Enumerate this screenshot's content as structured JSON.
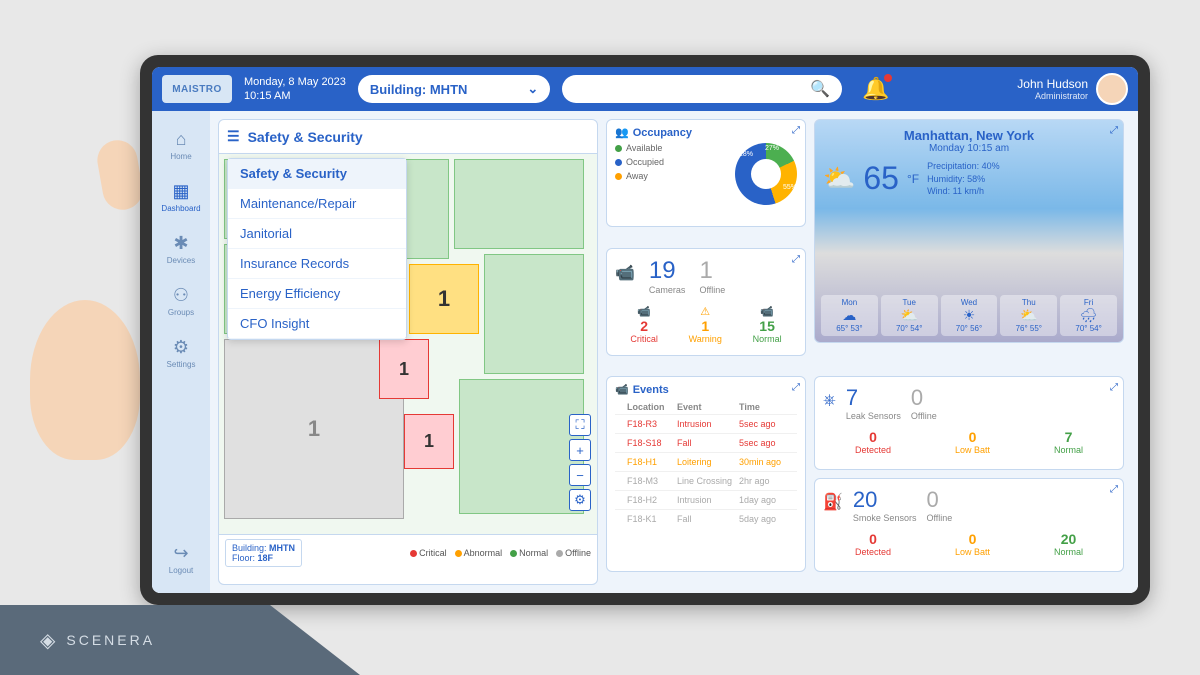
{
  "brand": "MAISTRO",
  "vendor": "SCENERA",
  "datetime": {
    "date": "Monday, 8 May 2023",
    "time": "10:15 AM"
  },
  "building_selector": {
    "label": "Building: MHTN"
  },
  "user": {
    "name": "John Hudson",
    "role": "Administrator"
  },
  "sidebar": {
    "items": [
      {
        "label": "Home",
        "icon": "⌂"
      },
      {
        "label": "Dashboard",
        "icon": "▦"
      },
      {
        "label": "Devices",
        "icon": "✱"
      },
      {
        "label": "Groups",
        "icon": "⚇"
      },
      {
        "label": "Settings",
        "icon": "⚙"
      }
    ],
    "logout": {
      "label": "Logout",
      "icon": "↪"
    }
  },
  "floorplan": {
    "title": "Safety & Security",
    "menu": [
      "Safety & Security",
      "Maintenance/Repair",
      "Janitorial",
      "Insurance Records",
      "Energy Efficiency",
      "CFO Insight"
    ],
    "building_label": "Building:",
    "building_val": "MHTN",
    "floor_label": "Floor:",
    "floor_val": "18F",
    "markers": {
      "gray": "1",
      "orange": "1",
      "red1": "1",
      "red2": "1"
    },
    "legend": [
      {
        "label": "Critical",
        "color": "#e53935"
      },
      {
        "label": "Abnormal",
        "color": "#ffa000"
      },
      {
        "label": "Normal",
        "color": "#43a047"
      },
      {
        "label": "Offline",
        "color": "#aaa"
      }
    ]
  },
  "occupancy": {
    "title": "Occupancy",
    "legend": [
      {
        "label": "Available",
        "color": "#4caf50"
      },
      {
        "label": "Occupied",
        "color": "#2962c7"
      },
      {
        "label": "Away",
        "color": "#ffb300"
      }
    ],
    "pct": {
      "avail": "18%",
      "occ": "55%",
      "away": "27%"
    }
  },
  "cameras": {
    "count": "19",
    "count_label": "Cameras",
    "offline": "1",
    "offline_label": "Offline",
    "stats": [
      {
        "n": "2",
        "label": "Critical",
        "cls": "clr-red",
        "ico": "📹"
      },
      {
        "n": "1",
        "label": "Warning",
        "cls": "clr-org",
        "ico": "⚠"
      },
      {
        "n": "15",
        "label": "Normal",
        "cls": "clr-grn",
        "ico": "📹"
      }
    ]
  },
  "events": {
    "title": "Events",
    "headers": [
      "",
      "Location",
      "Event",
      "Time"
    ],
    "rows": [
      {
        "color": "#e53935",
        "cls": "clr-red",
        "loc": "F18-R3",
        "ev": "Intrusion",
        "time": "5sec ago"
      },
      {
        "color": "#e53935",
        "cls": "clr-red",
        "loc": "F18-S18",
        "ev": "Fall",
        "time": "5sec ago"
      },
      {
        "color": "#ffa000",
        "cls": "clr-org",
        "loc": "F18-H1",
        "ev": "Loitering",
        "time": "30min ago"
      },
      {
        "color": "#ccc",
        "cls": "clr-gry",
        "loc": "F18-M3",
        "ev": "Line Crossing",
        "time": "2hr ago"
      },
      {
        "color": "#ccc",
        "cls": "clr-gry",
        "loc": "F18-H2",
        "ev": "Intrusion",
        "time": "1day ago"
      },
      {
        "color": "#ccc",
        "cls": "clr-gry",
        "loc": "F18-K1",
        "ev": "Fall",
        "time": "5day ago"
      }
    ]
  },
  "weather": {
    "location": "Manhattan, New York",
    "time": "Monday 10:15 am",
    "temp": "65",
    "unit": "°F",
    "details": {
      "precip": "Precipitation: 40%",
      "humidity": "Humidity: 58%",
      "wind": "Wind: 11 km/h"
    },
    "days": [
      {
        "d": "Mon",
        "i": "☁",
        "hi": "65°",
        "lo": "53°"
      },
      {
        "d": "Tue",
        "i": "⛅",
        "hi": "70°",
        "lo": "54°"
      },
      {
        "d": "Wed",
        "i": "☀",
        "hi": "70°",
        "lo": "56°"
      },
      {
        "d": "Thu",
        "i": "⛅",
        "hi": "76°",
        "lo": "55°"
      },
      {
        "d": "Fri",
        "i": "🌧",
        "hi": "70°",
        "lo": "54°"
      }
    ]
  },
  "leak": {
    "count": "7",
    "count_label": "Leak Sensors",
    "offline": "0",
    "offline_label": "Offline",
    "stats": [
      {
        "n": "0",
        "label": "Detected",
        "cls": "clr-red"
      },
      {
        "n": "0",
        "label": "Low Batt",
        "cls": "clr-org"
      },
      {
        "n": "7",
        "label": "Normal",
        "cls": "clr-grn"
      }
    ]
  },
  "smoke": {
    "count": "20",
    "count_label": "Smoke Sensors",
    "offline": "0",
    "offline_label": "Offline",
    "stats": [
      {
        "n": "0",
        "label": "Detected",
        "cls": "clr-red"
      },
      {
        "n": "0",
        "label": "Low Batt",
        "cls": "clr-org"
      },
      {
        "n": "20",
        "label": "Normal",
        "cls": "clr-grn"
      }
    ]
  }
}
